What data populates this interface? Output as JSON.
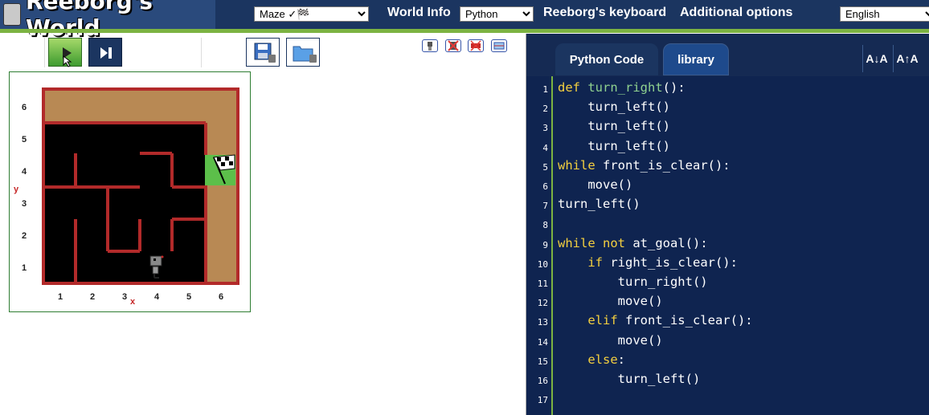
{
  "app": {
    "title": "Reeborg's World"
  },
  "header": {
    "world_select": "Maze ✓🏁",
    "world_info": "World Info",
    "language_select": "Python",
    "keyboard": "Reeborg's keyboard",
    "additional_options": "Additional options",
    "ui_language_select": "English"
  },
  "toolbar": {
    "run": "play-icon",
    "step": "step-icon",
    "save": "save-icon",
    "load": "open-folder-icon"
  },
  "world": {
    "x_axis_label": "x",
    "y_axis_label": "y",
    "x_ticks": [
      "1",
      "2",
      "3",
      "4",
      "5",
      "6"
    ],
    "y_ticks": [
      "6",
      "5",
      "4",
      "3",
      "2",
      "1"
    ]
  },
  "editor": {
    "tabs": [
      "Python Code",
      "library"
    ],
    "font_decrease": "A↓A",
    "font_increase": "A↑A",
    "line_numbers": [
      "1",
      "2",
      "3",
      "4",
      "5",
      "6",
      "7",
      "8",
      "9",
      "10",
      "11",
      "12",
      "13",
      "14",
      "15",
      "16",
      "17"
    ],
    "lines": [
      "def turn_right():",
      "    turn_left()",
      "    turn_left()",
      "    turn_left()",
      "while front_is_clear():",
      "    move()",
      "turn_left()",
      "",
      "while not at_goal():",
      "    if right_is_clear():",
      "        turn_right()",
      "        move()",
      "    elif front_is_clear():",
      "        move()",
      "    else:",
      "        turn_left()",
      ""
    ]
  }
}
